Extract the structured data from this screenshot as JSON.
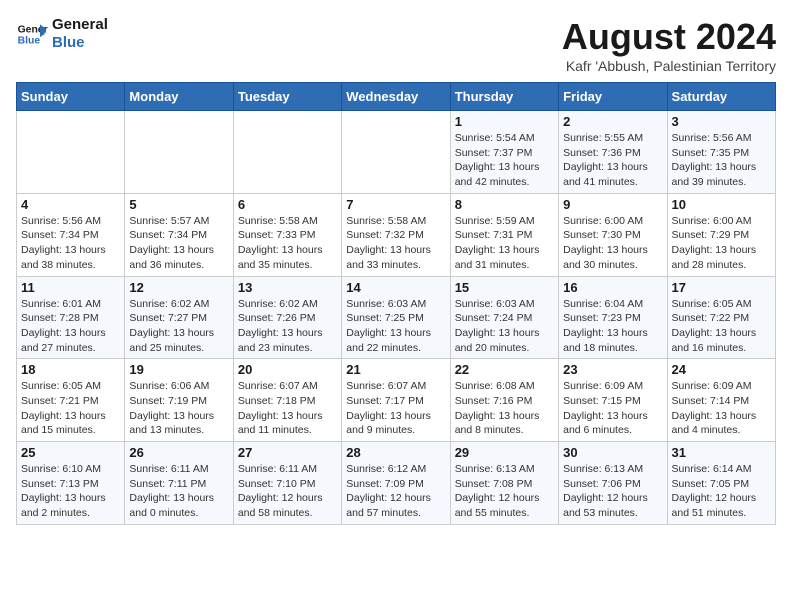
{
  "header": {
    "logo_line1": "General",
    "logo_line2": "Blue",
    "main_title": "August 2024",
    "subtitle": "Kafr 'Abbush, Palestinian Territory"
  },
  "calendar": {
    "days_of_week": [
      "Sunday",
      "Monday",
      "Tuesday",
      "Wednesday",
      "Thursday",
      "Friday",
      "Saturday"
    ],
    "weeks": [
      [
        {
          "day": "",
          "info": ""
        },
        {
          "day": "",
          "info": ""
        },
        {
          "day": "",
          "info": ""
        },
        {
          "day": "",
          "info": ""
        },
        {
          "day": "1",
          "info": "Sunrise: 5:54 AM\nSunset: 7:37 PM\nDaylight: 13 hours\nand 42 minutes."
        },
        {
          "day": "2",
          "info": "Sunrise: 5:55 AM\nSunset: 7:36 PM\nDaylight: 13 hours\nand 41 minutes."
        },
        {
          "day": "3",
          "info": "Sunrise: 5:56 AM\nSunset: 7:35 PM\nDaylight: 13 hours\nand 39 minutes."
        }
      ],
      [
        {
          "day": "4",
          "info": "Sunrise: 5:56 AM\nSunset: 7:34 PM\nDaylight: 13 hours\nand 38 minutes."
        },
        {
          "day": "5",
          "info": "Sunrise: 5:57 AM\nSunset: 7:34 PM\nDaylight: 13 hours\nand 36 minutes."
        },
        {
          "day": "6",
          "info": "Sunrise: 5:58 AM\nSunset: 7:33 PM\nDaylight: 13 hours\nand 35 minutes."
        },
        {
          "day": "7",
          "info": "Sunrise: 5:58 AM\nSunset: 7:32 PM\nDaylight: 13 hours\nand 33 minutes."
        },
        {
          "day": "8",
          "info": "Sunrise: 5:59 AM\nSunset: 7:31 PM\nDaylight: 13 hours\nand 31 minutes."
        },
        {
          "day": "9",
          "info": "Sunrise: 6:00 AM\nSunset: 7:30 PM\nDaylight: 13 hours\nand 30 minutes."
        },
        {
          "day": "10",
          "info": "Sunrise: 6:00 AM\nSunset: 7:29 PM\nDaylight: 13 hours\nand 28 minutes."
        }
      ],
      [
        {
          "day": "11",
          "info": "Sunrise: 6:01 AM\nSunset: 7:28 PM\nDaylight: 13 hours\nand 27 minutes."
        },
        {
          "day": "12",
          "info": "Sunrise: 6:02 AM\nSunset: 7:27 PM\nDaylight: 13 hours\nand 25 minutes."
        },
        {
          "day": "13",
          "info": "Sunrise: 6:02 AM\nSunset: 7:26 PM\nDaylight: 13 hours\nand 23 minutes."
        },
        {
          "day": "14",
          "info": "Sunrise: 6:03 AM\nSunset: 7:25 PM\nDaylight: 13 hours\nand 22 minutes."
        },
        {
          "day": "15",
          "info": "Sunrise: 6:03 AM\nSunset: 7:24 PM\nDaylight: 13 hours\nand 20 minutes."
        },
        {
          "day": "16",
          "info": "Sunrise: 6:04 AM\nSunset: 7:23 PM\nDaylight: 13 hours\nand 18 minutes."
        },
        {
          "day": "17",
          "info": "Sunrise: 6:05 AM\nSunset: 7:22 PM\nDaylight: 13 hours\nand 16 minutes."
        }
      ],
      [
        {
          "day": "18",
          "info": "Sunrise: 6:05 AM\nSunset: 7:21 PM\nDaylight: 13 hours\nand 15 minutes."
        },
        {
          "day": "19",
          "info": "Sunrise: 6:06 AM\nSunset: 7:19 PM\nDaylight: 13 hours\nand 13 minutes."
        },
        {
          "day": "20",
          "info": "Sunrise: 6:07 AM\nSunset: 7:18 PM\nDaylight: 13 hours\nand 11 minutes."
        },
        {
          "day": "21",
          "info": "Sunrise: 6:07 AM\nSunset: 7:17 PM\nDaylight: 13 hours\nand 9 minutes."
        },
        {
          "day": "22",
          "info": "Sunrise: 6:08 AM\nSunset: 7:16 PM\nDaylight: 13 hours\nand 8 minutes."
        },
        {
          "day": "23",
          "info": "Sunrise: 6:09 AM\nSunset: 7:15 PM\nDaylight: 13 hours\nand 6 minutes."
        },
        {
          "day": "24",
          "info": "Sunrise: 6:09 AM\nSunset: 7:14 PM\nDaylight: 13 hours\nand 4 minutes."
        }
      ],
      [
        {
          "day": "25",
          "info": "Sunrise: 6:10 AM\nSunset: 7:13 PM\nDaylight: 13 hours\nand 2 minutes."
        },
        {
          "day": "26",
          "info": "Sunrise: 6:11 AM\nSunset: 7:11 PM\nDaylight: 13 hours\nand 0 minutes."
        },
        {
          "day": "27",
          "info": "Sunrise: 6:11 AM\nSunset: 7:10 PM\nDaylight: 12 hours\nand 58 minutes."
        },
        {
          "day": "28",
          "info": "Sunrise: 6:12 AM\nSunset: 7:09 PM\nDaylight: 12 hours\nand 57 minutes."
        },
        {
          "day": "29",
          "info": "Sunrise: 6:13 AM\nSunset: 7:08 PM\nDaylight: 12 hours\nand 55 minutes."
        },
        {
          "day": "30",
          "info": "Sunrise: 6:13 AM\nSunset: 7:06 PM\nDaylight: 12 hours\nand 53 minutes."
        },
        {
          "day": "31",
          "info": "Sunrise: 6:14 AM\nSunset: 7:05 PM\nDaylight: 12 hours\nand 51 minutes."
        }
      ]
    ]
  }
}
